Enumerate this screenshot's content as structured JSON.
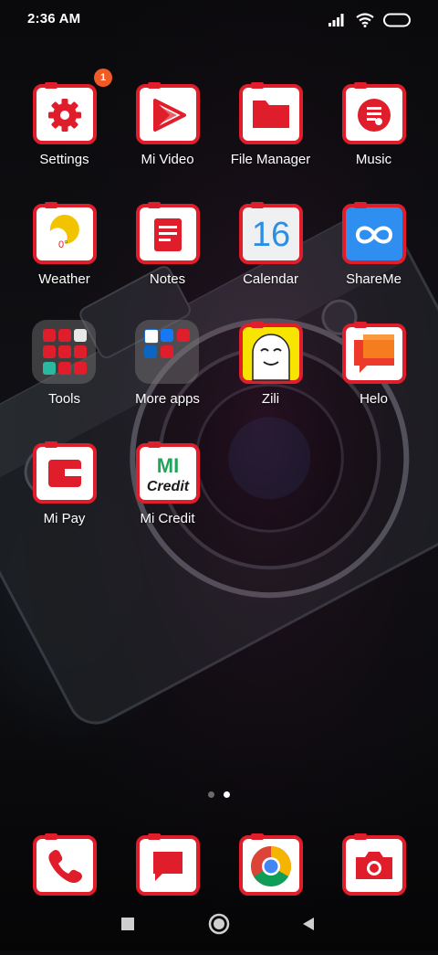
{
  "status_bar": {
    "time": "2:36 AM"
  },
  "apps": [
    {
      "label": "Settings",
      "badge": "1"
    },
    {
      "label": "Mi Video"
    },
    {
      "label": "File Manager"
    },
    {
      "label": "Music"
    },
    {
      "label": "Weather",
      "temp": "0°"
    },
    {
      "label": "Notes"
    },
    {
      "label": "Calendar",
      "day": "16"
    },
    {
      "label": "ShareMe"
    },
    {
      "label": "Tools"
    },
    {
      "label": "More apps"
    },
    {
      "label": "Zili"
    },
    {
      "label": "Helo"
    },
    {
      "label": "Mi Pay"
    },
    {
      "label": "Mi Credit",
      "logo_top": "MI",
      "logo_bottom": "Credit"
    }
  ],
  "dock": [
    "Phone",
    "Messaging",
    "Chrome",
    "Camera"
  ],
  "colors": {
    "theme_red": "#e01e2b",
    "badge": "#ef5a25",
    "accent_green": "#22a55a"
  },
  "page_indicator": {
    "pages": 2,
    "current": 2
  }
}
